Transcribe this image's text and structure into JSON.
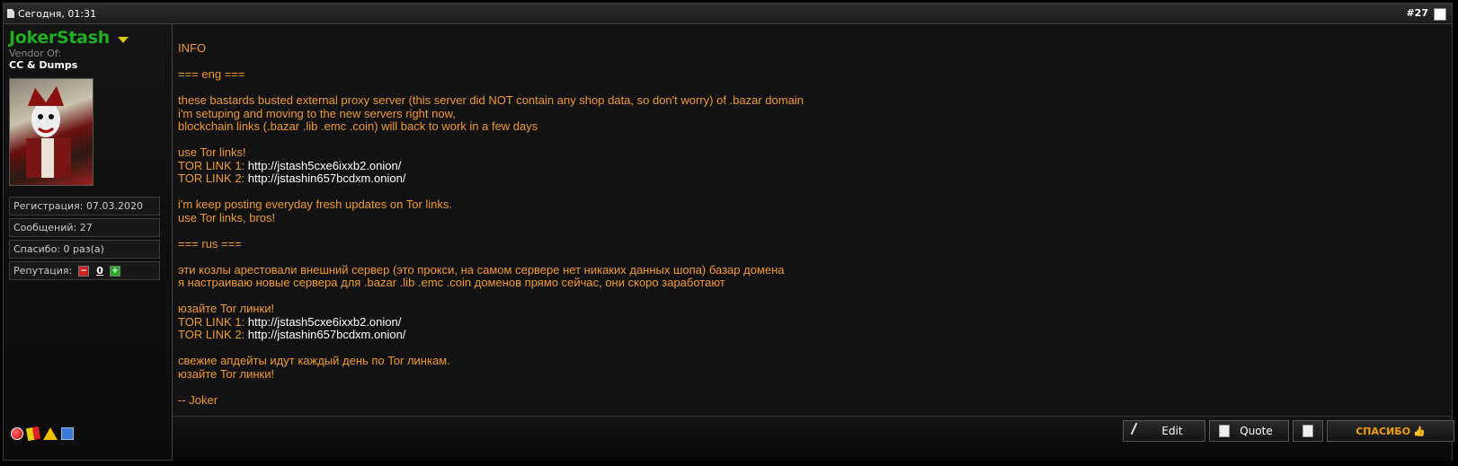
{
  "header": {
    "date": "Сегодня, 01:31",
    "post_number": "#27"
  },
  "user": {
    "name": "JokerStash",
    "title": "Vendor Of:",
    "vendor_of": "CC & Dumps",
    "registration": "Регистрация: 07.03.2020",
    "messages": "Сообщений: 27",
    "thanks": "Спасибо: 0 раз(а)",
    "reputation_label": "Репутация:",
    "reputation_value": "0"
  },
  "post_lines": [
    {
      "text": "INFO"
    },
    {
      "text": ""
    },
    {
      "text": "=== eng ==="
    },
    {
      "text": ""
    },
    {
      "text": "these bastards busted external proxy server (this server did NOT contain any shop data, so don't worry) of .bazar domain"
    },
    {
      "text": "i'm setuping and moving to the new servers right now,"
    },
    {
      "text": "blockchain links (.bazar .lib .emc .coin) will back to work in a few days"
    },
    {
      "text": ""
    },
    {
      "text": "use Tor links!"
    },
    {
      "text": "TOR LINK 1: ",
      "link": "http://jstash5cxe6ixxb2.onion/"
    },
    {
      "text": "TOR LINK 2: ",
      "link": "http://jstashin657bcdxm.onion/"
    },
    {
      "text": ""
    },
    {
      "text": "i'm keep posting everyday fresh updates on Tor links."
    },
    {
      "text": "use Tor links, bros!"
    },
    {
      "text": ""
    },
    {
      "text": "=== rus ==="
    },
    {
      "text": ""
    },
    {
      "text": "эти козлы арестовали внешний сервер (это прокси, на самом сервере нет никаких данных шопа) базар домена"
    },
    {
      "text": "я настраиваю новые сервера для .bazar .lib .emc .coin доменов прямо сейчас, они скоро заработают"
    },
    {
      "text": ""
    },
    {
      "text": "юзайте Tor линки!"
    },
    {
      "text": "TOR LINK 1: ",
      "link": "http://jstash5cxe6ixxb2.onion/"
    },
    {
      "text": "TOR LINK 2: ",
      "link": "http://jstashin657bcdxm.onion/"
    },
    {
      "text": ""
    },
    {
      "text": "свежие апдейты идут каждый день по Tor линкам."
    },
    {
      "text": "юзайте Tor линки!"
    },
    {
      "text": ""
    },
    {
      "text": "-- Joker"
    }
  ],
  "footer": {
    "edit_label": "Edit",
    "quote_label": "Quote",
    "thanks_label": "СПАСИБО"
  },
  "colors": {
    "post_text": "#f09a30",
    "username": "#1fae1f",
    "link": "#ffffff"
  }
}
